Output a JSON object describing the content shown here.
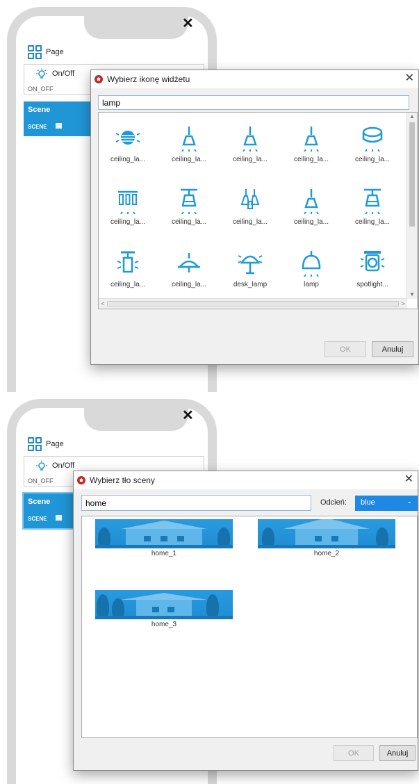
{
  "phone": {
    "close_label": "✕",
    "page_label": "Page",
    "onoff_title": "On/Off",
    "onoff_type": "ON_OFF",
    "scene_title": "Scene",
    "scene_type": "SCENE"
  },
  "icon_dialog": {
    "title": "Wybierz ikonę widżetu",
    "close": "✕",
    "search_value": "lamp",
    "icons": [
      {
        "label": "ceiling_la...",
        "icon": "ceiling-lamp-globe-icon"
      },
      {
        "label": "ceiling_la...",
        "icon": "ceiling-lamp-pendant-icon"
      },
      {
        "label": "ceiling_la...",
        "icon": "ceiling-lamp-pendant-icon"
      },
      {
        "label": "ceiling_la...",
        "icon": "ceiling-lamp-pendant-icon"
      },
      {
        "label": "ceiling_la...",
        "icon": "ceiling-lamp-flush-icon"
      },
      {
        "label": "ceiling_la...",
        "icon": "ceiling-lamp-triple-icon"
      },
      {
        "label": "ceiling_la...",
        "icon": "ceiling-lamp-shade-icon"
      },
      {
        "label": "ceiling_la...",
        "icon": "ceiling-lamp-chandelier-icon"
      },
      {
        "label": "ceiling_la...",
        "icon": "ceiling-lamp-pendant-icon"
      },
      {
        "label": "ceiling_la...",
        "icon": "ceiling-lamp-shade-icon"
      },
      {
        "label": "ceiling_la...",
        "icon": "ceiling-lamp-cylinder-icon"
      },
      {
        "label": "ceiling_la...",
        "icon": "ceiling-lamp-dome-icon"
      },
      {
        "label": "desk_lamp",
        "icon": "desk-lamp-icon"
      },
      {
        "label": "lamp",
        "icon": "lamp-icon"
      },
      {
        "label": "spotlight...",
        "icon": "spotlight-icon"
      }
    ],
    "ok_label": "OK",
    "cancel_label": "Anuluj"
  },
  "bg_dialog": {
    "title": "Wybierz tło sceny",
    "close": "✕",
    "search_value": "home",
    "tint_label": "Odcień:",
    "tint_value": "blue",
    "items": [
      {
        "label": "home_1"
      },
      {
        "label": "home_2"
      },
      {
        "label": "home_3"
      }
    ],
    "ok_label": "OK",
    "cancel_label": "Anuluj"
  },
  "colors": {
    "accent": "#1e9ad6",
    "scene_bg": "#2196d6",
    "tint_select": "#1e88e5"
  }
}
